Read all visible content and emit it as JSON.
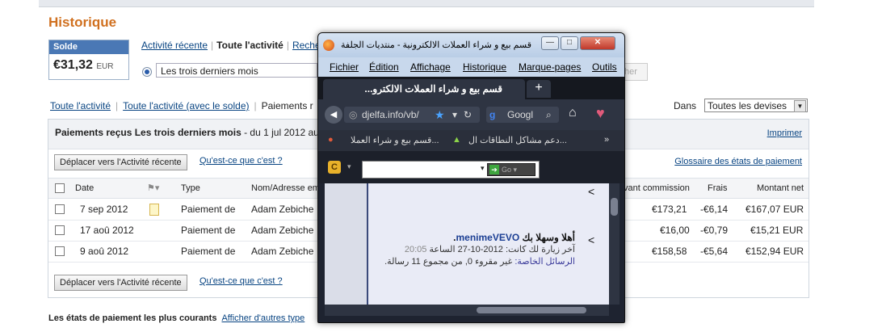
{
  "page": {
    "title": "Historique",
    "balance_label": "Solde",
    "balance_amount": "€31,32",
    "balance_currency": "EUR",
    "tabs": [
      "Activité récente",
      "Toute l'activité",
      "Reche"
    ],
    "period_value": "Les trois derniers mois",
    "search_button": "her",
    "links": [
      "Toute l'activité",
      "Toute l'activité (avec le solde)",
      "Paiements r"
    ],
    "currency_label": "Dans",
    "currency_value": "Toutes les devises"
  },
  "panel": {
    "header_bold": "Paiements reçus Les trois derniers mois",
    "header_rest": " - du 1 jul 2012 au",
    "print_link": "Imprimer",
    "move_button": "Déplacer vers l'Activité récente",
    "what_link": "Qu'est-ce que c'est ?",
    "glossary_link": "Glossaire des états de paiement",
    "columns": {
      "date": "Date",
      "type": "Type",
      "name": "Nom/Adresse em",
      "before_fee": "vant commission",
      "fee": "Frais",
      "net": "Montant net"
    },
    "rows": [
      {
        "date": "7 sep 2012",
        "type": "Paiement de",
        "name": "Adam Zebiche",
        "gross": "€173,21",
        "fee": "-€6,14",
        "net": "€167,07 EUR"
      },
      {
        "date": "17 aoû 2012",
        "type": "Paiement de",
        "name": "Adam Zebiche",
        "gross": "€16,00",
        "fee": "-€0,79",
        "net": "€15,21 EUR"
      },
      {
        "date": "9 aoû 2012",
        "type": "Paiement de",
        "name": "Adam Zebiche",
        "gross": "€158,58",
        "fee": "-€5,64",
        "net": "€152,94 EUR"
      }
    ]
  },
  "footer": {
    "label": "Les états de paiement les plus courants",
    "link": "Afficher d'autres type"
  },
  "popup": {
    "window_title": "قسم بيع و شراء العملات الالكترونية - منتديات الجلفة لكل ا...",
    "menu": [
      "Fichier",
      "Édition",
      "Affichage",
      "Historique",
      "Marque-pages",
      "Outils"
    ],
    "tab_title": "قسم بيع و شراء العملات الالكترو...",
    "new_tab": "+",
    "url": "djelfa.info/vb/",
    "search_engine": "Googl",
    "bookmark_1": "قسم بيع و شراء العملا...",
    "bookmark_2": "دعم مشاكل النطاقات ال...",
    "go_label": "Go",
    "welcome": "أهلا وسهلا بك",
    "username": "menimeVEVO",
    "last_visit": "آخر زيارة لك كانت: 2012-10-27 الساعة",
    "last_visit_time": "20:05",
    "pm_label": "الرسائل الخاصة:",
    "pm_text": "غير مقروء 0, من مجموع 11 رسالة."
  },
  "colors": {
    "accent": "#d0701f",
    "link": "#084482",
    "balance_header": "#4a78b5"
  }
}
